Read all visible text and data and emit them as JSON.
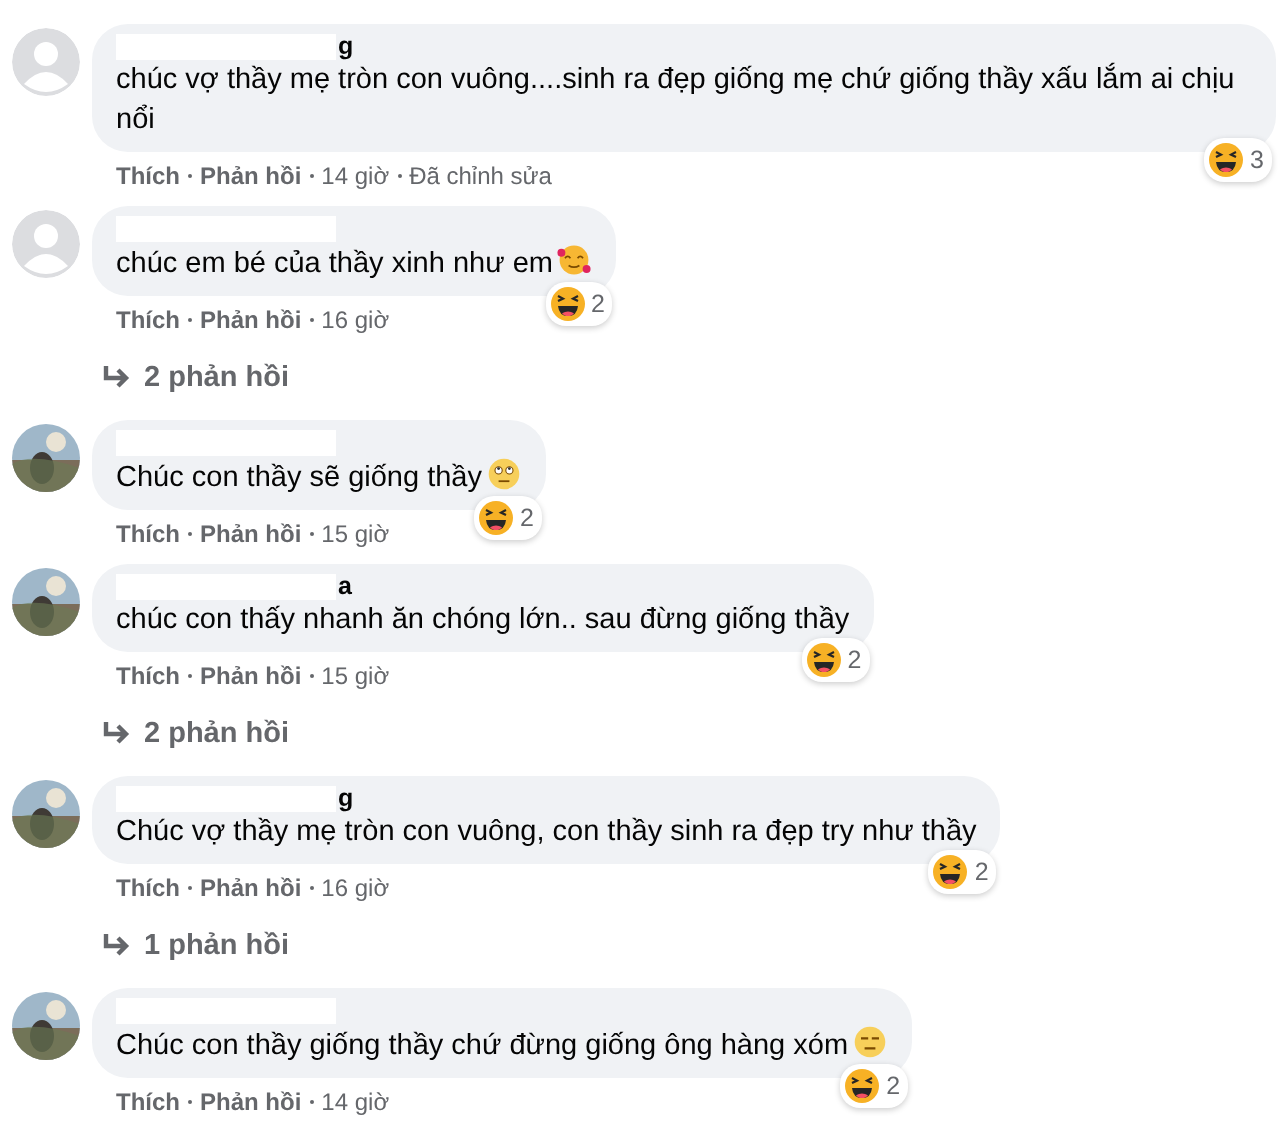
{
  "comments": [
    {
      "avatar": {
        "kind": "default"
      },
      "name_fragment": "g",
      "text": "chúc vợ thầy mẹ tròn con vuông....sinh ra đẹp giống mẹ chứ giống thầy xấu lắm ai chịu nổi",
      "reaction_count": "3",
      "like": "Thích",
      "reply": "Phản hồi",
      "time": "14 giờ",
      "edited": "Đã chỉnh sửa"
    },
    {
      "avatar": {
        "kind": "default"
      },
      "text": "chúc em bé của thầy xinh như em",
      "inline_icon": {
        "kind": "hearts"
      },
      "reaction_count": "2",
      "like": "Thích",
      "reply": "Phản hồi",
      "time": "16 giờ",
      "replies": "2 phản hồi"
    },
    {
      "text": "Chúc con thầy sẽ giống thầy",
      "inline_icon": {
        "kind": "eyeroll"
      },
      "reaction_count": "2",
      "like": "Thích",
      "reply": "Phản hồi",
      "time": "15 giờ"
    },
    {
      "name_fragment": "a",
      "text": "chúc con thấy nhanh ăn chóng lớn.. sau đừng giống thầy",
      "reaction_count": "2",
      "like": "Thích",
      "reply": "Phản hồi",
      "time": "15 giờ",
      "replies": "2 phản hồi"
    },
    {
      "name_fragment": "g",
      "text": "Chúc vợ thầy mẹ tròn con vuông, con thầy sinh ra đẹp try như thầy",
      "reaction_count": "2",
      "like": "Thích",
      "reply": "Phản hồi",
      "time": "16 giờ",
      "replies": "1 phản hồi"
    },
    {
      "text": "Chúc con thầy giống thầy chứ đừng giống ông hàng xóm",
      "inline_icon": {
        "kind": "expressionless"
      },
      "reaction_count": "2",
      "like": "Thích",
      "reply": "Phản hồi",
      "time": "14 giờ"
    }
  ]
}
